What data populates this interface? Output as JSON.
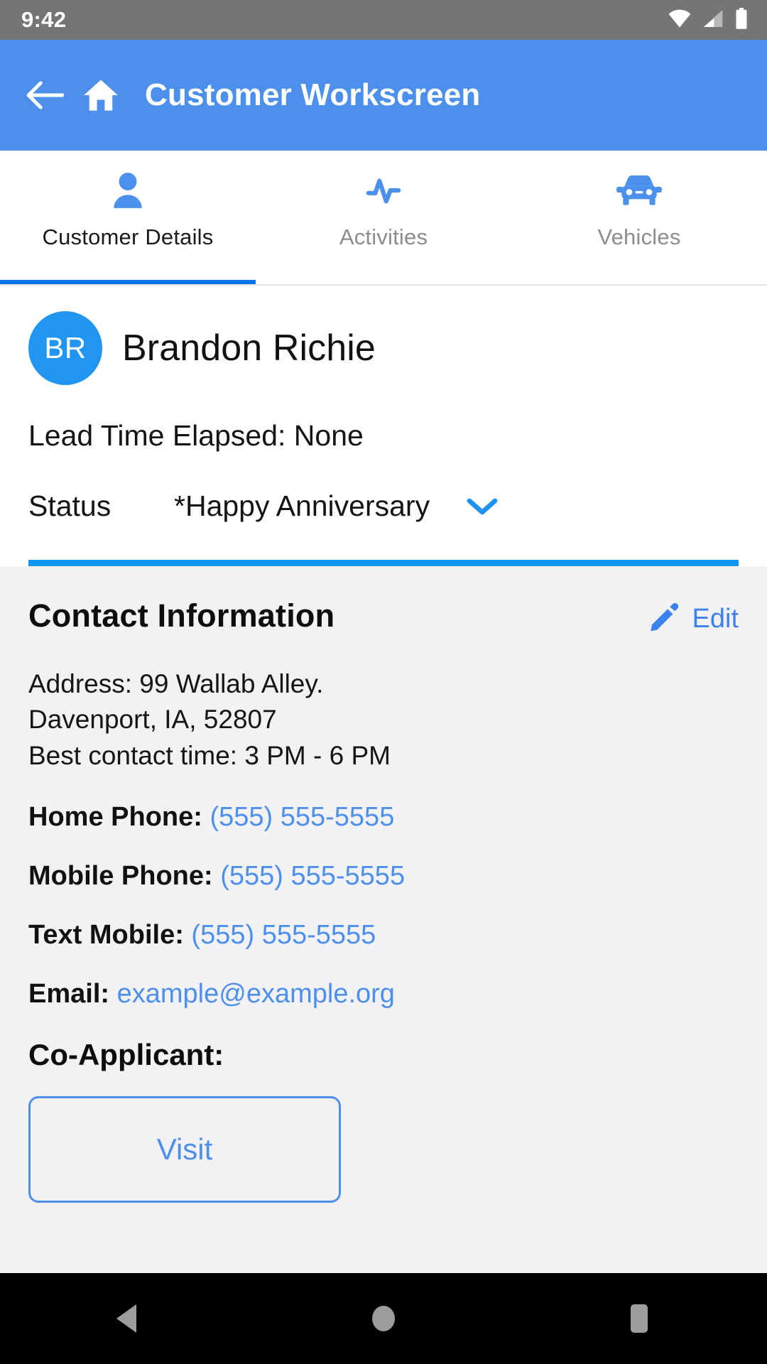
{
  "status_bar": {
    "time": "9:42",
    "icons": [
      "wifi-icon",
      "cell-signal-icon",
      "battery-icon"
    ]
  },
  "app_bar": {
    "back_icon": "back-arrow-icon",
    "home_icon": "home-icon",
    "title": "Customer Workscreen",
    "background_color": "#4d90ec"
  },
  "tabs": [
    {
      "label": "Customer Details",
      "icon": "person-icon",
      "active": true
    },
    {
      "label": "Activities",
      "icon": "pulse-icon",
      "active": false
    },
    {
      "label": "Vehicles",
      "icon": "car-icon",
      "active": false
    }
  ],
  "customer": {
    "initials": "BR",
    "name": "Brandon Richie",
    "lead_time": "Lead Time Elapsed: None",
    "status_label": "Status",
    "status_value": "*Happy Anniversary",
    "status_caret_icon": "chevron-down-icon",
    "avatar_color": "#2095f2",
    "divider_color": "#0d96f2"
  },
  "contact": {
    "title": "Contact Information",
    "edit_label": "Edit",
    "edit_icon": "pencil-icon",
    "address_lines": [
      "Address: 99 Wallab Alley.",
      "Davenport, IA, 52807",
      "Best contact time: 3 PM - 6 PM"
    ],
    "fields": [
      {
        "label": "Home Phone:",
        "value": "(555) 555-5555"
      },
      {
        "label": "Mobile Phone:",
        "value": "(555) 555-5555"
      },
      {
        "label": "Text Mobile:",
        "value": "(555) 555-5555"
      },
      {
        "label": "Email:",
        "value": "example@example.org"
      }
    ],
    "co_applicant_label": "Co-Applicant:",
    "visit_button": "Visit",
    "link_color": "#4d90ec",
    "background_color": "#f2f1f4"
  },
  "nav_bar": {
    "back": "nav-back-icon",
    "home": "nav-home-icon",
    "recents": "nav-recents-icon"
  }
}
